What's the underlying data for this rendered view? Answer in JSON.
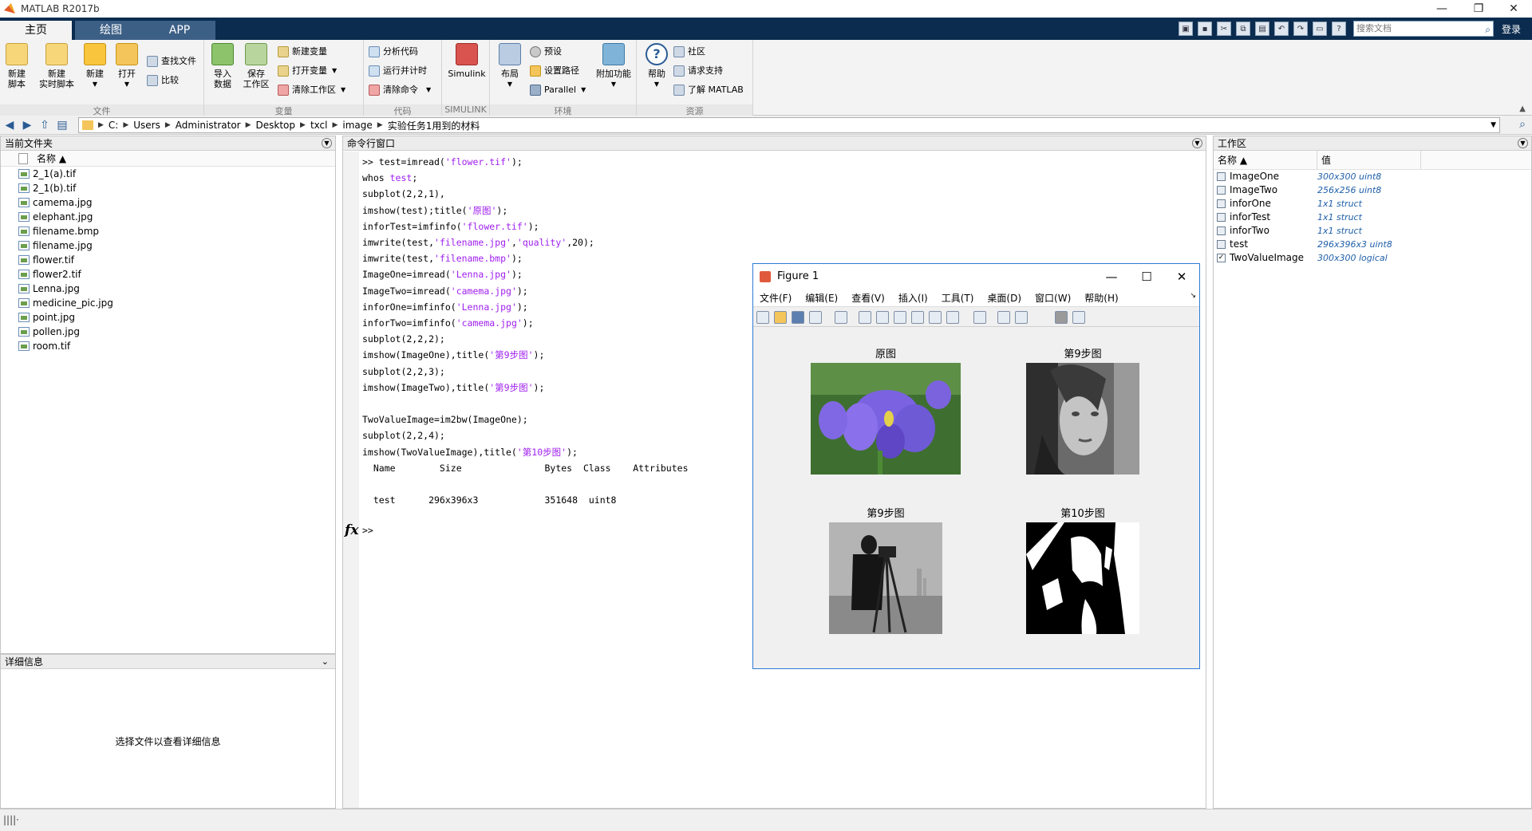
{
  "app": {
    "title": "MATLAB R2017b"
  },
  "ribbon_tabs": [
    "主页",
    "绘图",
    "APP"
  ],
  "search": {
    "placeholder": "搜索文档"
  },
  "login_label": "登录",
  "ribbon": {
    "file_group": {
      "label": "文件",
      "new_script": "新建\n脚本",
      "new_live_script": "新建\n实时脚本",
      "new": "新建",
      "open": "打开",
      "find_files": "查找文件",
      "compare": "比较"
    },
    "variable_group": {
      "label": "变量",
      "import_data": "导入\n数据",
      "save_workspace": "保存\n工作区",
      "new_variable": "新建变量",
      "open_variable": "打开变量",
      "clear_workspace": "清除工作区"
    },
    "code_group": {
      "label": "代码",
      "analyze_code": "分析代码",
      "run_and_time": "运行并计时",
      "clear_commands": "清除命令"
    },
    "simulink_group": {
      "label": "SIMULINK",
      "simulink": "Simulink"
    },
    "environment_group": {
      "label": "环境",
      "layout": "布局",
      "preferences": "预设",
      "set_path": "设置路径",
      "parallel": "Parallel",
      "add_ons": "附加功能"
    },
    "resources_group": {
      "label": "资源",
      "help": "帮助",
      "community": "社区",
      "request_support": "请求支持",
      "learn_matlab": "了解 MATLAB"
    }
  },
  "path": [
    "C:",
    "Users",
    "Administrator",
    "Desktop",
    "txcl",
    "image",
    "实验任务1用到的材料"
  ],
  "current_folder": {
    "title": "当前文件夹",
    "column_name": "名称 ▲",
    "files": [
      "2_1(a).tif",
      "2_1(b).tif",
      "camema.jpg",
      "elephant.jpg",
      "filename.bmp",
      "filename.jpg",
      "flower.tif",
      "flower2.tif",
      "Lenna.jpg",
      "medicine_pic.jpg",
      "point.jpg",
      "pollen.jpg",
      "room.tif"
    ]
  },
  "details": {
    "title": "详细信息",
    "message": "选择文件以查看详细信息"
  },
  "command_window": {
    "title": "命令行窗口",
    "prompt": ">>"
  },
  "workspace": {
    "title": "工作区",
    "col_name": "名称 ▲",
    "col_value": "值",
    "vars": [
      {
        "name": "ImageOne",
        "value": "300x300 uint8"
      },
      {
        "name": "ImageTwo",
        "value": "256x256 uint8"
      },
      {
        "name": "inforOne",
        "value": "1x1 struct"
      },
      {
        "name": "inforTest",
        "value": "1x1 struct"
      },
      {
        "name": "inforTwo",
        "value": "1x1 struct"
      },
      {
        "name": "test",
        "value": "296x396x3 uint8"
      },
      {
        "name": "TwoValueImage",
        "value": "300x300 logical"
      }
    ]
  },
  "figure": {
    "title": "Figure 1",
    "menu": [
      "文件(F)",
      "编辑(E)",
      "查看(V)",
      "插入(I)",
      "工具(T)",
      "桌面(D)",
      "窗口(W)",
      "帮助(H)"
    ],
    "subplots": [
      "原图",
      "第9步图",
      "第9步图",
      "第10步图"
    ]
  },
  "colors": {
    "tab_bar": "#0b2c4f",
    "string": "#a020f0",
    "workspace_value": "#1f5fa8",
    "figure_border": "#2e7bd6"
  }
}
